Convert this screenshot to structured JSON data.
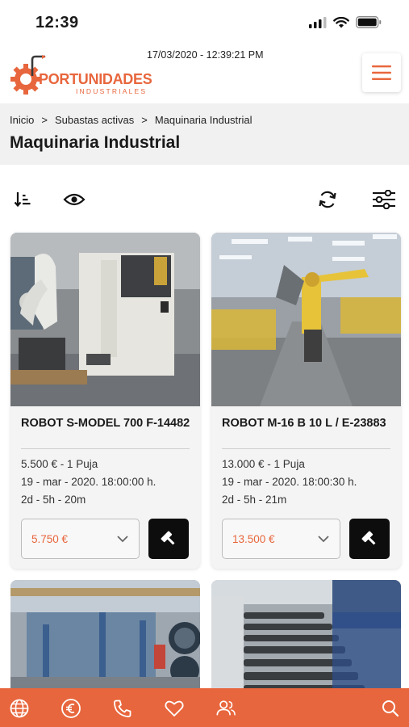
{
  "status_bar": {
    "time": "12:39",
    "icons": [
      "signal-icon",
      "wifi-icon",
      "battery-icon"
    ]
  },
  "header": {
    "datetime": "17/03/2020 - 12:39:21 PM",
    "logo_text": "PORTUNIDADES",
    "logo_sub": "INDUSTRIALES",
    "menu_icon": "hamburger-menu-icon"
  },
  "breadcrumb": {
    "items": [
      "Inicio",
      "Subastas activas",
      "Maquinaria Industrial"
    ],
    "separator": ">"
  },
  "page_title": "Maquinaria Industrial",
  "toolbar": {
    "icons": [
      "sort-icon",
      "eye-icon",
      "refresh-icon",
      "filter-sliders-icon"
    ]
  },
  "cards": [
    {
      "title": "ROBOT S-MODEL 700 F-14482",
      "price_line": "5.500 € - 1 Puja",
      "date_line": "19 - mar - 2020. 18:00:00 h.",
      "remaining": "2d - 5h - 20m",
      "bid_value": "5.750 €",
      "bid_button_icon": "gavel-icon"
    },
    {
      "title": "ROBOT M-16 B 10 L / E-23883",
      "price_line": "13.000 € - 1 Puja",
      "date_line": "19 - mar - 2020. 18:00:30 h.",
      "remaining": "2d - 5h - 21m",
      "bid_value": "13.500 €",
      "bid_button_icon": "gavel-icon"
    }
  ],
  "bottom_nav": {
    "icons": [
      "globe-icon",
      "euro-icon",
      "phone-icon",
      "heart-icon",
      "users-icon",
      "search-icon"
    ]
  },
  "colors": {
    "accent": "#e8663d",
    "dark": "#0d0d0d",
    "crumb_bg": "#f1f1f1"
  }
}
